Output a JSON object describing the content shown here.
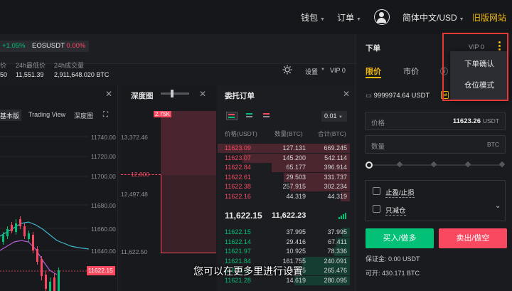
{
  "topnav": {
    "wallet": "钱包",
    "orders": "订单",
    "language": "简体中文/USD",
    "old_site": "旧版网站"
  },
  "ticker": {
    "pct_change": "+1.05%",
    "pair": "EOSUSDT",
    "pair_change": "0.00%",
    "col1_label": "价",
    "col1_value": "50",
    "low_label": "24h最低价",
    "low_value": "11,551.39",
    "volume_label": "24h成交量",
    "volume_value": "2,911,648.020 BTC"
  },
  "toolbar": {
    "settings": "设置",
    "vip": "VIP 0"
  },
  "chart": {
    "tab_basic": "基本版",
    "tab_tradingview": "Trading View",
    "tab_depth": "深度图",
    "price_ticks": [
      "11740.00",
      "11720.00",
      "11700.00",
      "11680.00",
      "11660.00",
      "11640.00"
    ],
    "current_price": "11622.15",
    "series_color_up": "#02c076",
    "series_color_down": "#f84960"
  },
  "depth": {
    "title": "深度图",
    "top_label": "2.75K",
    "axis": [
      "13,372.46",
      "12,800",
      "12,497.48",
      "11,622.50"
    ]
  },
  "orderbook": {
    "title": "委托订单",
    "precision": "0.01",
    "headers": {
      "price": "价格(USDT)",
      "qty": "数量(BTC)",
      "total": "合计(BTC)"
    },
    "asks": [
      {
        "price": "11623.09",
        "qty": "127.131",
        "total": "669.245",
        "depth": 1.0
      },
      {
        "price": "11623.07",
        "qty": "145.200",
        "total": "542.114",
        "depth": 0.81
      },
      {
        "price": "11622.84",
        "qty": "65.177",
        "total": "396.914",
        "depth": 0.59
      },
      {
        "price": "11622.61",
        "qty": "29.503",
        "total": "331.737",
        "depth": 0.5
      },
      {
        "price": "11622.38",
        "qty": "257.915",
        "total": "302.234",
        "depth": 0.45
      },
      {
        "price": "11622.16",
        "qty": "44.319",
        "total": "44.319",
        "depth": 0.07
      }
    ],
    "last_price": "11,622.15",
    "last_price_sub": "11,622.23",
    "bids": [
      {
        "price": "11622.15",
        "qty": "37.995",
        "total": "37.995",
        "depth": 0.06
      },
      {
        "price": "11622.14",
        "qty": "29.416",
        "total": "67.411",
        "depth": 0.1
      },
      {
        "price": "11621.97",
        "qty": "10.925",
        "total": "78.336",
        "depth": 0.12
      },
      {
        "price": "11621.84",
        "qty": "161.755",
        "total": "240.091",
        "depth": 0.36
      },
      {
        "price": "11621.61",
        "qty": "25.375",
        "total": "265.476",
        "depth": 0.4
      },
      {
        "price": "11621.28",
        "qty": "14.619",
        "total": "280.095",
        "depth": 0.42
      }
    ]
  },
  "order_form": {
    "title": "下单",
    "vip": "VIP 0",
    "tabs": {
      "limit": "限价",
      "market": "市价",
      "stop": "限"
    },
    "balance": "9999974.64 USDT",
    "price_label": "价格",
    "price_value": "11623.26",
    "price_unit": "USDT",
    "qty_label": "数量",
    "qty_unit": "BTC",
    "tpsl_label": "止盈/止损",
    "reduce_label": "只减仓",
    "buy_label": "买入/做多",
    "sell_label": "卖出/做空",
    "margin_label": "保证金: 0.00 USDT",
    "available_label": "可开: 430.171 BTC",
    "buy_color": "#02c076",
    "sell_color": "#f84960"
  },
  "dropdown": {
    "item1": "下单确认",
    "item2": "仓位模式"
  },
  "caption": "您可以在更多里进行设置"
}
